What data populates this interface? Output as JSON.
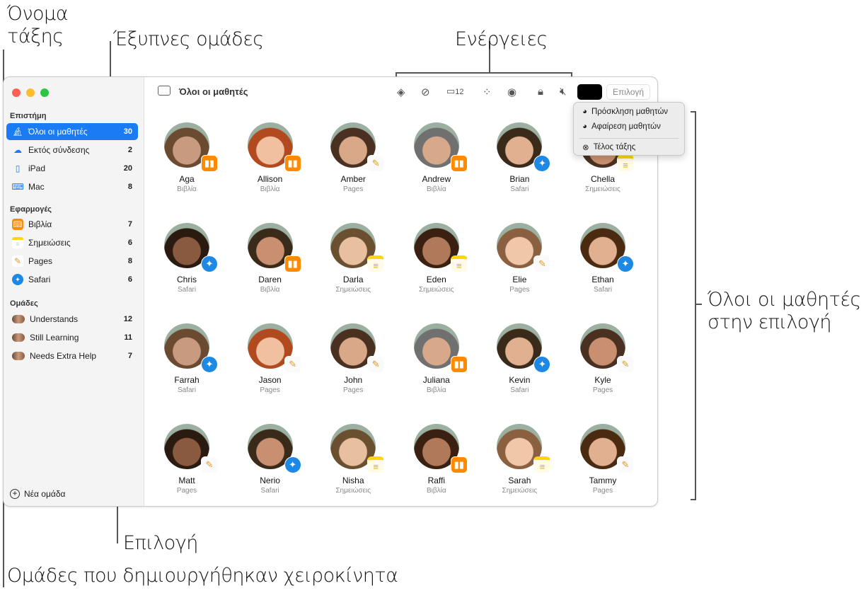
{
  "callouts": {
    "class_name": "Όνομα\nτάξης",
    "smart_groups": "Έξυπνες ομάδες",
    "actions": "Ενέργειες",
    "all_students": "Όλοι οι μαθητές\nστην επιλογή",
    "selection": "Επιλογή",
    "manual_groups": "Ομάδες που δημιουργήθηκαν χειροκίνητα"
  },
  "sidebar": {
    "class_section": "Επιστήμη",
    "class_items": [
      {
        "label": "Όλοι οι μαθητές",
        "count": "30",
        "icon": "microscope-icon"
      },
      {
        "label": "Εκτός σύνδεσης",
        "count": "2",
        "icon": "cloud-offline-icon"
      },
      {
        "label": "iPad",
        "count": "20",
        "icon": "ipad-icon"
      },
      {
        "label": "Mac",
        "count": "8",
        "icon": "laptop-icon"
      }
    ],
    "apps_section": "Εφαρμογές",
    "app_items": [
      {
        "label": "Βιβλία",
        "count": "7",
        "icon": "books-icon"
      },
      {
        "label": "Σημειώσεις",
        "count": "6",
        "icon": "notes-icon"
      },
      {
        "label": "Pages",
        "count": "8",
        "icon": "pages-icon"
      },
      {
        "label": "Safari",
        "count": "6",
        "icon": "safari-icon"
      }
    ],
    "groups_section": "Ομάδες",
    "group_items": [
      {
        "label": "Understands",
        "count": "12"
      },
      {
        "label": "Still Learning",
        "count": "11"
      },
      {
        "label": "Needs Extra Help",
        "count": "7"
      }
    ],
    "new_group": "Νέα ομάδα"
  },
  "toolbar": {
    "title": "Όλοι οι μαθητές",
    "inbox_count": "12",
    "select_label": "Επιλογή"
  },
  "menu": {
    "items": [
      "Πρόσκληση μαθητών",
      "Αφαίρεση μαθητών",
      "Τέλος τάξης"
    ]
  },
  "colors": {
    "accent": "#1a7cf5",
    "books": "#ff8a00",
    "safari": "#1e88e5",
    "notes": "#ffd60a"
  },
  "students": [
    {
      "name": "Aga",
      "app": "Βιβλία"
    },
    {
      "name": "Allison",
      "app": "Βιβλία"
    },
    {
      "name": "Amber",
      "app": "Pages"
    },
    {
      "name": "Andrew",
      "app": "Βιβλία"
    },
    {
      "name": "Brian",
      "app": "Safari"
    },
    {
      "name": "Chella",
      "app": "Σημειώσεις"
    },
    {
      "name": "Chris",
      "app": "Safari"
    },
    {
      "name": "Daren",
      "app": "Βιβλία"
    },
    {
      "name": "Darla",
      "app": "Σημειώσεις"
    },
    {
      "name": "Eden",
      "app": "Σημειώσεις"
    },
    {
      "name": "Elie",
      "app": "Pages"
    },
    {
      "name": "Ethan",
      "app": "Safari"
    },
    {
      "name": "Farrah",
      "app": "Safari"
    },
    {
      "name": "Jason",
      "app": "Pages"
    },
    {
      "name": "John",
      "app": "Pages"
    },
    {
      "name": "Juliana",
      "app": "Βιβλία"
    },
    {
      "name": "Kevin",
      "app": "Safari"
    },
    {
      "name": "Kyle",
      "app": "Pages"
    },
    {
      "name": "Matt",
      "app": "Pages"
    },
    {
      "name": "Nerio",
      "app": "Safari"
    },
    {
      "name": "Nisha",
      "app": "Σημειώσεις"
    },
    {
      "name": "Raffi",
      "app": "Βιβλία"
    },
    {
      "name": "Sarah",
      "app": "Σημειώσεις"
    },
    {
      "name": "Tammy",
      "app": "Pages"
    }
  ]
}
